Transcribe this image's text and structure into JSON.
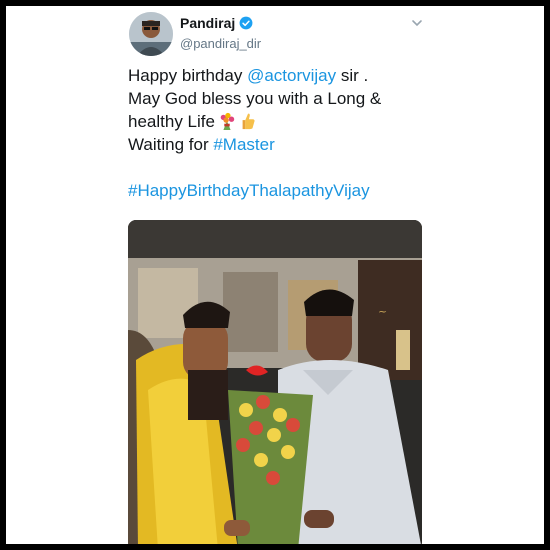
{
  "tweet": {
    "author": {
      "display_name": "Pandiraj",
      "handle": "@pandiraj_dir",
      "verified": true,
      "avatar_icon": "profile-photo"
    },
    "menu_icon": "chevron-down-icon",
    "text": {
      "line1_prefix": "Happy birthday ",
      "mention": "@actorvijay",
      "line1_suffix": " sir .",
      "line2": "May God bless you with a Long &",
      "line3": "healthy Life",
      "emojis": [
        "bouquet-emoji",
        "thumbs-up-emoji"
      ],
      "line4_prefix": "Waiting for ",
      "hashtag1": "#Master",
      "hashtag2": "#HappyBirthdayThalapathyVijay"
    },
    "colors": {
      "link": "#1b95e0",
      "text": "#14171a",
      "secondary": "#657786",
      "verified": "#1da1f2"
    },
    "media": {
      "type": "photo"
    }
  }
}
